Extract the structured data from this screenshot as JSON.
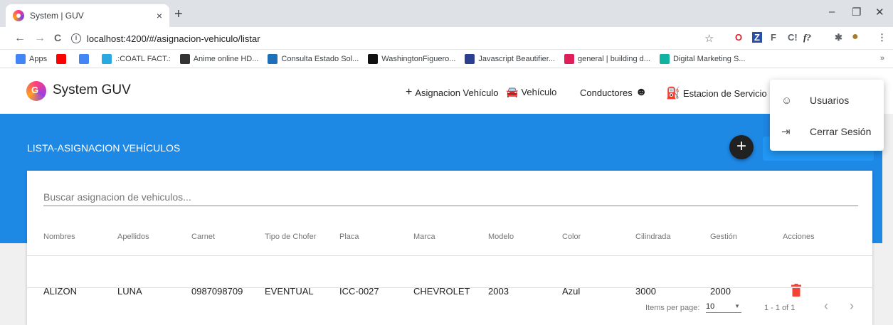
{
  "browser": {
    "tab_title": "System | GUV",
    "tab_close": "×",
    "new_tab": "+",
    "window_controls": [
      "–",
      "❐",
      "✕"
    ],
    "url": "localhost:4200/#/asignacion-vehiculo/listar",
    "nav": [
      "←",
      "→",
      "C"
    ],
    "extensions": [
      "☆",
      "O",
      "Z",
      "F",
      "C!",
      "f?",
      "✱",
      "●",
      "⋮"
    ],
    "bookmarks": [
      {
        "label": "Apps",
        "icon": "apps-grid-icon",
        "color": "#4285f4"
      },
      {
        "label": "",
        "icon": "youtube-icon",
        "color": "#ff0000"
      },
      {
        "label": "",
        "icon": "google-icon",
        "color": "#4285f4"
      },
      {
        "label": ".:COATL FACT.:",
        "icon": "coatl-icon",
        "color": "#2aa8e0"
      },
      {
        "label": "Anime online HD...",
        "icon": "anime-icon",
        "color": "#333333"
      },
      {
        "label": "Consulta Estado Sol...",
        "icon": "document-icon",
        "color": "#1e6fb8"
      },
      {
        "label": "WashingtonFiguero...",
        "icon": "github-icon",
        "color": "#111111"
      },
      {
        "label": "Javascript Beautifier...",
        "icon": "beautifier-icon",
        "color": "#2c3e8f"
      },
      {
        "label": "general | building d...",
        "icon": "slack-icon",
        "color": "#e01e5a"
      },
      {
        "label": "Digital Marketing S...",
        "icon": "px-icon",
        "color": "#0fb39f"
      }
    ],
    "bookmarks_more": "»"
  },
  "app": {
    "title": "System GUV",
    "nav": [
      {
        "label": "Asignacion Vehículo",
        "icon_char": "+"
      },
      {
        "label": "Vehículo",
        "icon_char": "🚘"
      },
      {
        "label": "Conductores",
        "icon_char": "☻"
      },
      {
        "label": "Estacion de Servicio",
        "icon_char": "⛽"
      }
    ]
  },
  "page": {
    "title": "LISTA-ASIGNACION VEHÍCULOS",
    "fab": "+",
    "search_placeholder": "Buscar asignacion de vehiculos..."
  },
  "table": {
    "columns": [
      "Nombres",
      "Apellidos",
      "Carnet",
      "Tipo de Chofer",
      "Placa",
      "Marca",
      "Modelo",
      "Color",
      "Cilindrada",
      "Gestión",
      "Acciones"
    ],
    "rows": [
      [
        "ALIZON",
        "LUNA",
        "0987098709",
        "EVENTUAL",
        "ICC-0027",
        "CHEVROLET",
        "2003",
        "Azul",
        "3000",
        "2000"
      ]
    ],
    "delete_color": "#f44336"
  },
  "paginator": {
    "items_per_page_label": "Items per page:",
    "page_size": "10",
    "range": "1 - 1 of 1",
    "prev": "‹",
    "next": "›"
  },
  "menu": {
    "items": [
      {
        "label": "Usuarios",
        "icon_char": "☺"
      },
      {
        "label": "Cerrar Sesión",
        "icon_char": "⇥"
      }
    ]
  },
  "colors": {
    "banner": "#1e88e5",
    "fab": "#212121"
  }
}
